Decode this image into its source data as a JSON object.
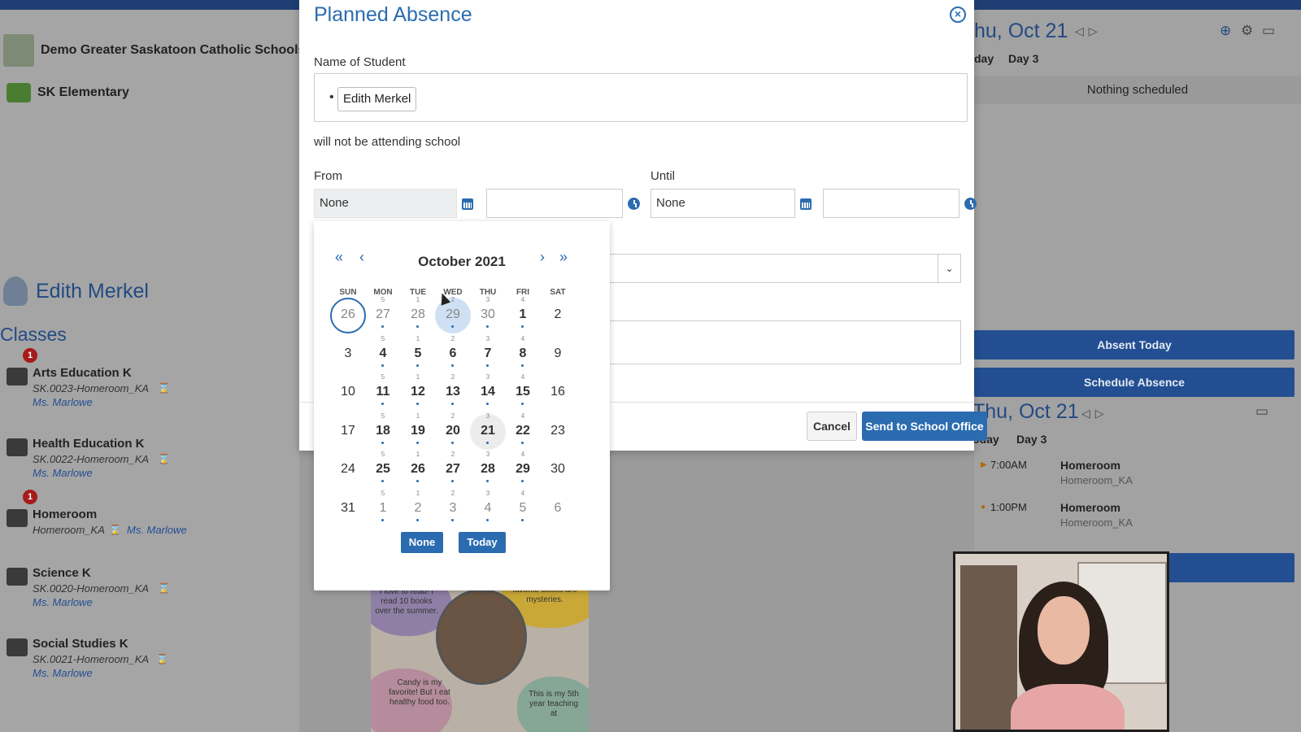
{
  "schools": [
    {
      "name": "Demo Greater Saskatoon Catholic Schools"
    },
    {
      "name": "SK Elementary"
    }
  ],
  "student": {
    "name": "Edith Merkel"
  },
  "classes_title": "Classes",
  "classes": [
    {
      "name": "Arts Education K",
      "code": "SK.0023-Homeroom_KA",
      "teacher": "Ms. Marlowe",
      "badge": "1"
    },
    {
      "name": "Health Education K",
      "code": "SK.0022-Homeroom_KA",
      "teacher": "Ms. Marlowe",
      "badge": ""
    },
    {
      "name": "Homeroom",
      "code": "Homeroom_KA",
      "teacher": "Ms. Marlowe",
      "badge": "1"
    },
    {
      "name": "Science K",
      "code": "SK.0020-Homeroom_KA",
      "teacher": "Ms. Marlowe",
      "badge": ""
    },
    {
      "name": "Social Studies K",
      "code": "SK.0021-Homeroom_KA",
      "teacher": "Ms. Marlowe",
      "badge": ""
    }
  ],
  "right_panel": {
    "date_top": "hu, Oct 21",
    "today_top": "day",
    "day_top": "Day 3",
    "nothing": "Nothing scheduled",
    "absent_today": "Absent Today",
    "schedule_absence": "Schedule Absence",
    "date_bottom": "Thu, Oct 21",
    "today_bottom": "oday",
    "day_bottom": "Day 3",
    "schedule": [
      {
        "time": "7:00AM",
        "title": "Homeroom",
        "sub": "Homeroom_KA"
      },
      {
        "time": "1:00PM",
        "title": "Homeroom",
        "sub": "Homeroom_KA"
      }
    ]
  },
  "book_card": {
    "text1": "I love to read! I read 10 books over the summer.",
    "text2": "favorite books are mysteries.",
    "text3": "Candy is my favorite! But I eat healthy food too.",
    "text4": "This is my 5th year teaching at"
  },
  "modal": {
    "title": "Planned Absence",
    "name_label": "Name of Student",
    "student_chip": "Edith Merkel",
    "attending_text": "will not be attending school",
    "from_label": "From",
    "until_label": "Until",
    "from_date": "None",
    "from_time": "",
    "until_date": "None",
    "until_time": "",
    "cancel": "Cancel",
    "send": "Send to School Office"
  },
  "picker": {
    "month": "October 2021",
    "nav_prev_year": "«",
    "nav_prev": "‹",
    "nav_next": "›",
    "nav_next_year": "»",
    "dow": [
      "SUN",
      "MON",
      "TUE",
      "WED",
      "THU",
      "FRI",
      "SAT"
    ],
    "weeks": [
      [
        {
          "n": "26",
          "m": true,
          "s": "",
          "d": false,
          "ring": true
        },
        {
          "n": "27",
          "m": true,
          "s": "5",
          "d": true
        },
        {
          "n": "28",
          "m": true,
          "s": "1",
          "d": true
        },
        {
          "n": "29",
          "m": true,
          "s": "2",
          "d": true,
          "blue": true
        },
        {
          "n": "30",
          "m": true,
          "s": "3",
          "d": true
        },
        {
          "n": "1",
          "s": "4",
          "d": true,
          "b": true
        },
        {
          "n": "2",
          "s": "",
          "d": false
        }
      ],
      [
        {
          "n": "3",
          "s": "",
          "d": false
        },
        {
          "n": "4",
          "s": "5",
          "d": true,
          "b": true
        },
        {
          "n": "5",
          "s": "1",
          "d": true,
          "b": true
        },
        {
          "n": "6",
          "s": "2",
          "d": true,
          "b": true
        },
        {
          "n": "7",
          "s": "3",
          "d": true,
          "b": true
        },
        {
          "n": "8",
          "s": "4",
          "d": true,
          "b": true
        },
        {
          "n": "9",
          "s": "",
          "d": false
        }
      ],
      [
        {
          "n": "10",
          "s": "",
          "d": false
        },
        {
          "n": "11",
          "s": "5",
          "d": true,
          "b": true
        },
        {
          "n": "12",
          "s": "1",
          "d": true,
          "b": true
        },
        {
          "n": "13",
          "s": "2",
          "d": true,
          "b": true
        },
        {
          "n": "14",
          "s": "3",
          "d": true,
          "b": true
        },
        {
          "n": "15",
          "s": "4",
          "d": true,
          "b": true
        },
        {
          "n": "16",
          "s": "",
          "d": false
        }
      ],
      [
        {
          "n": "17",
          "s": "",
          "d": false
        },
        {
          "n": "18",
          "s": "5",
          "d": true,
          "b": true
        },
        {
          "n": "19",
          "s": "1",
          "d": true,
          "b": true
        },
        {
          "n": "20",
          "s": "2",
          "d": true,
          "b": true
        },
        {
          "n": "21",
          "s": "3",
          "d": true,
          "b": true,
          "grey": true
        },
        {
          "n": "22",
          "s": "4",
          "d": true,
          "b": true
        },
        {
          "n": "23",
          "s": "",
          "d": false
        }
      ],
      [
        {
          "n": "24",
          "s": "",
          "d": false
        },
        {
          "n": "25",
          "s": "5",
          "d": true,
          "b": true
        },
        {
          "n": "26",
          "s": "1",
          "d": true,
          "b": true
        },
        {
          "n": "27",
          "s": "2",
          "d": true,
          "b": true
        },
        {
          "n": "28",
          "s": "3",
          "d": true,
          "b": true
        },
        {
          "n": "29",
          "s": "4",
          "d": true,
          "b": true
        },
        {
          "n": "30",
          "s": "",
          "d": false
        }
      ],
      [
        {
          "n": "31",
          "s": "",
          "d": false
        },
        {
          "n": "1",
          "m": true,
          "s": "5",
          "d": true
        },
        {
          "n": "2",
          "m": true,
          "s": "1",
          "d": true
        },
        {
          "n": "3",
          "m": true,
          "s": "2",
          "d": true
        },
        {
          "n": "4",
          "m": true,
          "s": "3",
          "d": true
        },
        {
          "n": "5",
          "m": true,
          "s": "4",
          "d": true
        },
        {
          "n": "6",
          "m": true,
          "s": "",
          "d": false
        }
      ]
    ],
    "none_btn": "None",
    "today_btn": "Today"
  }
}
